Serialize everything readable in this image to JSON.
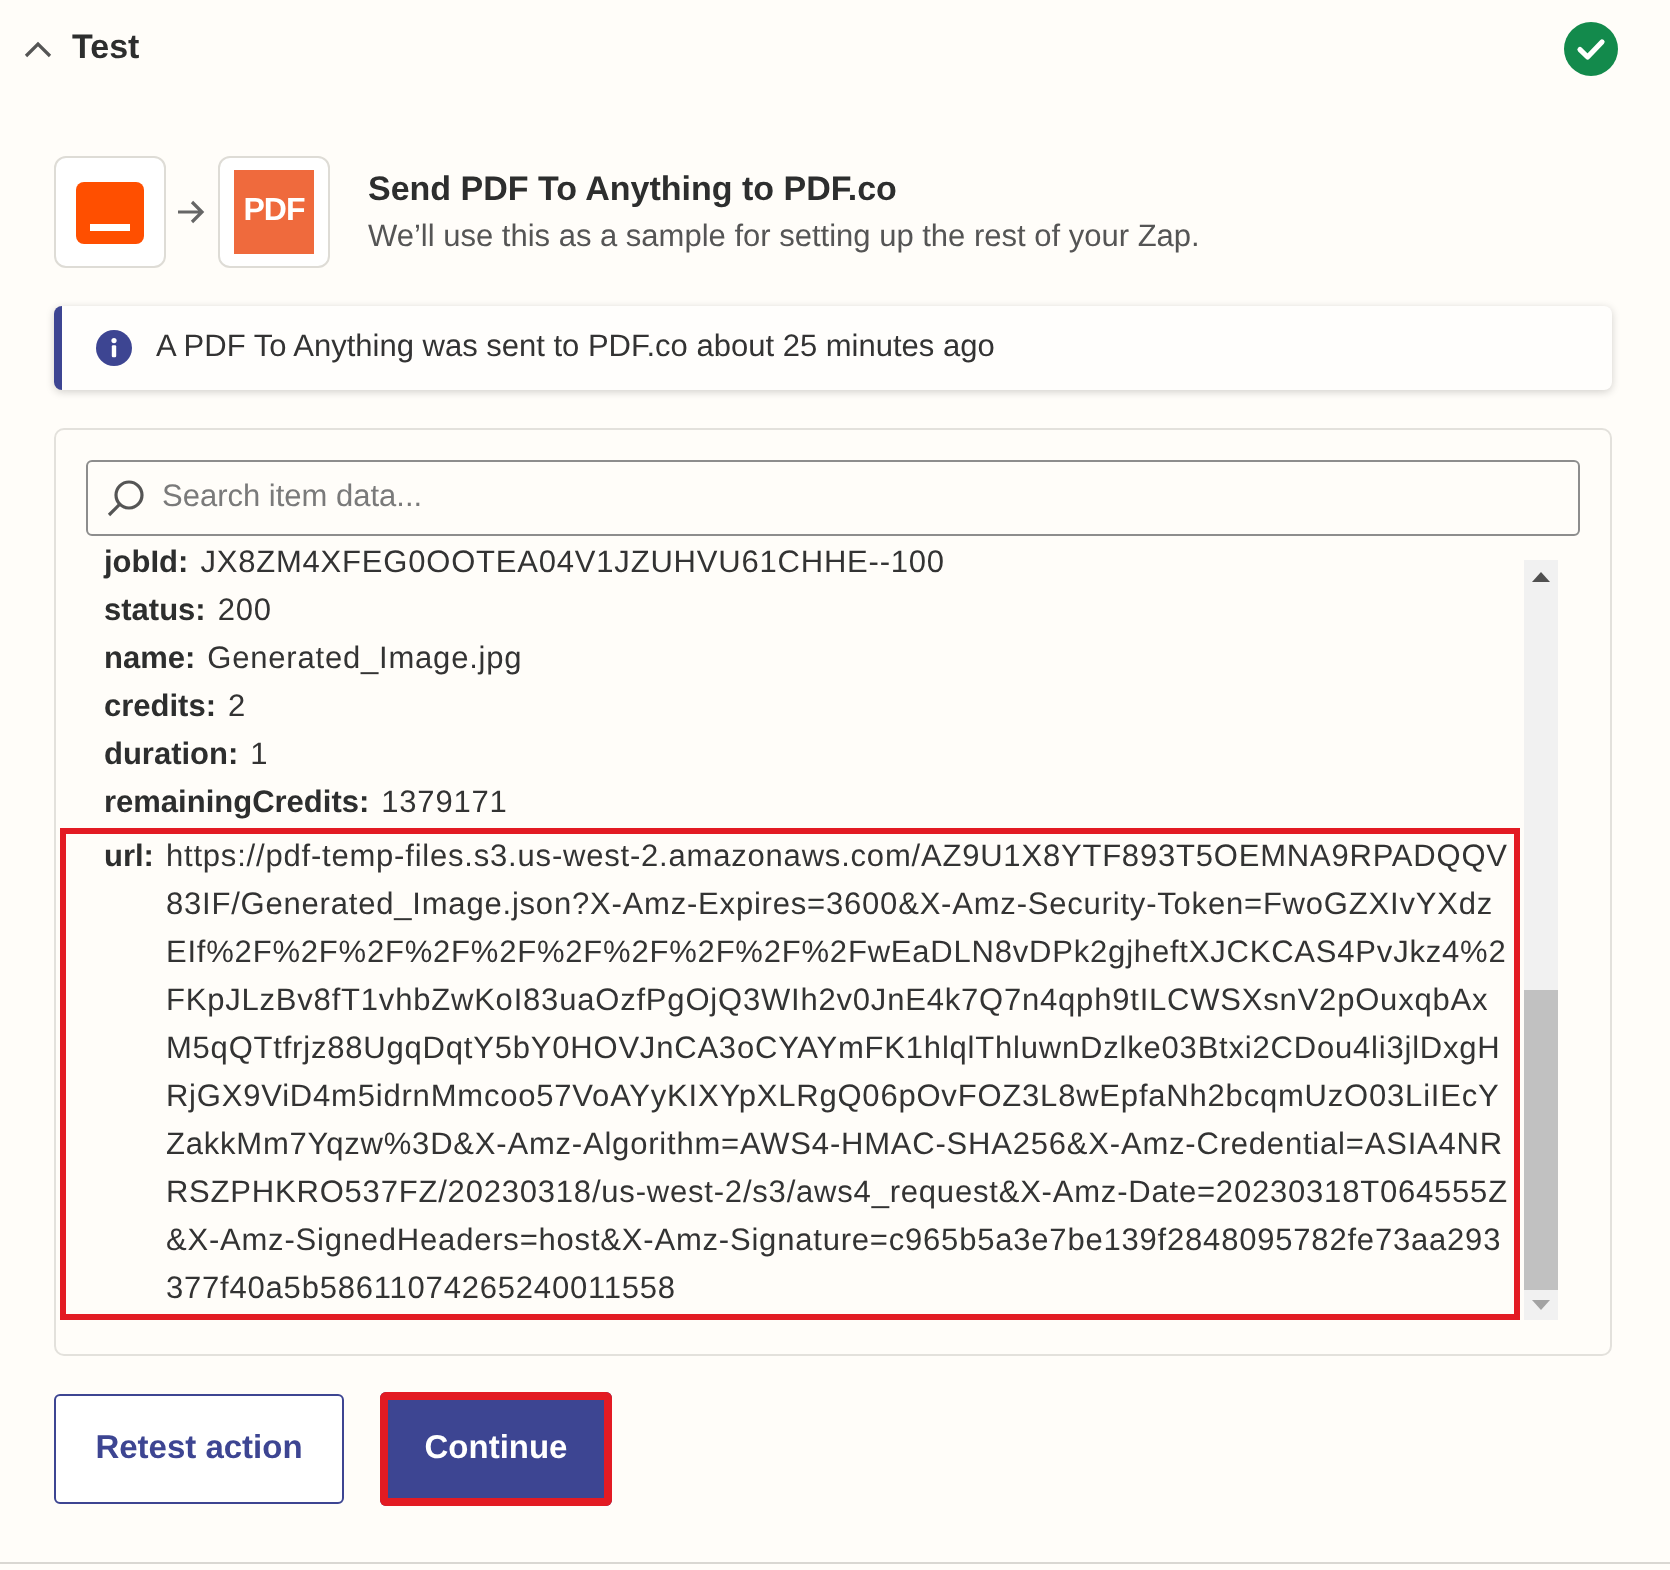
{
  "section": {
    "title": "Test",
    "expanded": true,
    "complete": true
  },
  "step": {
    "logos": [
      {
        "kind": "source"
      },
      {
        "kind": "pdf",
        "text": "PDF"
      }
    ],
    "title": "Send PDF To Anything to PDF.co",
    "subtitle": "We’ll use this as a sample for setting up the rest of your Zap."
  },
  "notice": {
    "text": "A PDF To Anything was sent to PDF.co about 25 minutes ago"
  },
  "data_panel": {
    "search": {
      "placeholder": "Search item data..."
    },
    "fields": [
      {
        "label": "jobId:",
        "value": "JX8ZM4XFEG0OOTEA04V1JZUHVU61CHHE--100",
        "highlighted": false
      },
      {
        "label": "status:",
        "value": "200",
        "highlighted": false
      },
      {
        "label": "name:",
        "value": "Generated_Image.jpg",
        "highlighted": false
      },
      {
        "label": "credits:",
        "value": "2",
        "highlighted": false
      },
      {
        "label": "duration:",
        "value": "1",
        "highlighted": false
      },
      {
        "label": "remainingCredits:",
        "value": "1379171",
        "highlighted": false
      },
      {
        "label": "url:",
        "value": "https://pdf-temp-files.s3.us-west-2.amazonaws.com/AZ9U1X8YTF893T5OEMNA9RPADQQV83IF/Generated_Image.json?X-Amz-Expires=3600&X-Amz-Security-Token=FwoGZXIvYXdzEIf%2F%2F%2F%2F%2F%2F%2F%2F%2F%2FwEaDLN8vDPk2gjheftXJCKCAS4PvJkz4%2FKpJLzBv8fT1vhbZwKoI83uaOzfPgOjQ3WIh2v0JnE4k7Q7n4qph9tILCWSXsnV2pOuxqbAxM5qQTtfrjz88UgqDqtY5bY0HOVJnCA3oCYAYmFK1hlqlThluwnDzlke03Btxi2CDou4li3jlDxgHRjGX9ViD4m5idrnMmcoo57VoAYyKIXYpXLRgQ06pOvFOZ3L8wEpfaNh2bcqmUzO03LiIEcYZakkMm7Yqzw%3D&X-Amz-Algorithm=AWS4-HMAC-SHA256&X-Amz-Credential=ASIA4NRRSZPHKRO537FZ/20230318/us-west-2/s3/aws4_request&X-Amz-Date=20230318T064555Z&X-Amz-SignedHeaders=host&X-Amz-Signature=c965b5a3e7be139f2848095782fe73aa293377f40a5b58611074265240011558",
        "highlighted": true
      }
    ]
  },
  "buttons": [
    {
      "label": "Retest action",
      "kind": "secondary",
      "highlighted": false
    },
    {
      "label": "Continue",
      "kind": "primary",
      "highlighted": true
    }
  ]
}
